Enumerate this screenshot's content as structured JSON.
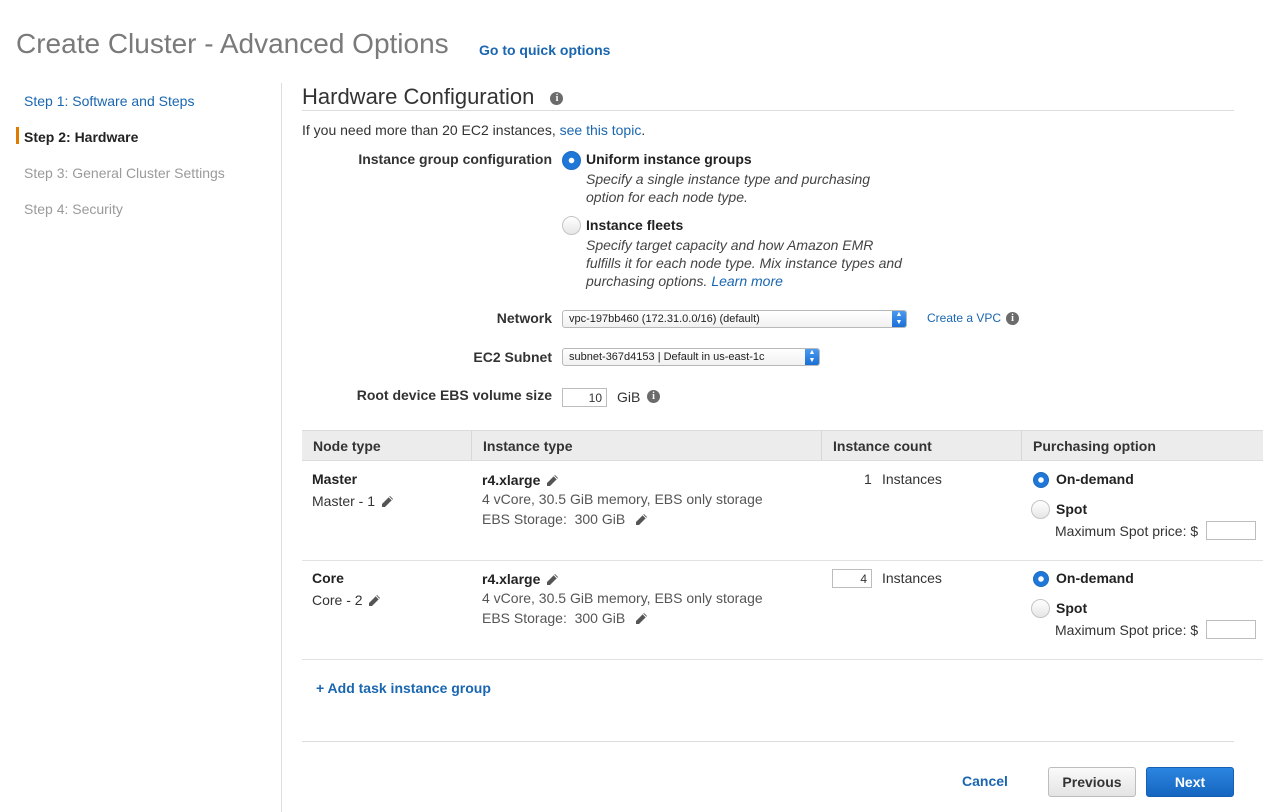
{
  "header": {
    "title": "Create Cluster - Advanced Options",
    "quick_link": "Go to quick options"
  },
  "sidebar": {
    "steps": [
      {
        "label": "Step 1: Software and Steps",
        "state": "link"
      },
      {
        "label": "Step 2: Hardware",
        "state": "active"
      },
      {
        "label": "Step 3: General Cluster Settings",
        "state": "disabled"
      },
      {
        "label": "Step 4: Security",
        "state": "disabled"
      }
    ]
  },
  "section": {
    "title": "Hardware Configuration",
    "intro_text": "If you need more than 20 EC2 instances, ",
    "intro_link": "see this topic",
    "intro_end": "."
  },
  "instance_group_config": {
    "label": "Instance group configuration",
    "selected": "uniform",
    "options": [
      {
        "title": "Uniform instance groups",
        "desc_line1": "Specify a single instance type and purchasing",
        "desc_line2": "option for each node type."
      },
      {
        "title": "Instance fleets",
        "desc_line1": "Specify target capacity and how Amazon EMR",
        "desc_line2": "fulfills it for each node type. Mix instance types and",
        "desc_line3": "purchasing options. ",
        "learn_more": "Learn more"
      }
    ]
  },
  "network": {
    "label": "Network",
    "value": "vpc-197bb460 (172.31.0.0/16) (default)",
    "create_link": "Create a VPC"
  },
  "subnet": {
    "label": "EC2 Subnet",
    "value": "subnet-367d4153 | Default in us-east-1c"
  },
  "ebs": {
    "label": "Root device EBS volume size",
    "value": "10",
    "unit": "GiB"
  },
  "table": {
    "headers": [
      "Node type",
      "Instance type",
      "Instance count",
      "Purchasing option"
    ],
    "rows": [
      {
        "node_type": "Master",
        "node_name": "Master - 1",
        "instance_type": "r4.xlarge",
        "specs": "4 vCore, 30.5 GiB memory, EBS only storage",
        "ebs_storage_label": "EBS Storage:",
        "ebs_storage_value": "300 GiB",
        "count": "1",
        "count_unit": "Instances",
        "on_demand": "On-demand",
        "spot": "Spot",
        "max_spot": "Maximum Spot price: $",
        "selected": "on-demand"
      },
      {
        "node_type": "Core",
        "node_name": "Core - 2",
        "instance_type": "r4.xlarge",
        "specs": "4 vCore, 30.5 GiB memory, EBS only storage",
        "ebs_storage_label": "EBS Storage:",
        "ebs_storage_value": "300 GiB",
        "count": "4",
        "count_unit": "Instances",
        "on_demand": "On-demand",
        "spot": "Spot",
        "max_spot": "Maximum Spot price: $",
        "selected": "on-demand"
      }
    ]
  },
  "add_task": "+ Add task instance group",
  "footer": {
    "cancel": "Cancel",
    "previous": "Previous",
    "next": "Next"
  },
  "icons": {
    "info": "info-icon",
    "edit": "pencil-icon",
    "select_arrows": "updown-arrow-icon"
  },
  "colors": {
    "link": "#1a66b0",
    "accent_marker": "#e07b00",
    "primary_button": "#1f77d8"
  }
}
